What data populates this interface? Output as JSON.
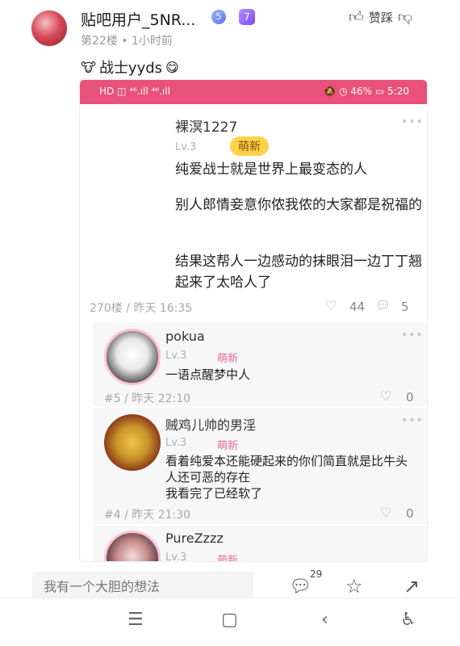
{
  "post": {
    "username": "贴吧用户_5NR...",
    "badge_number": "5",
    "badge_level": "7",
    "meta": "第22楼 • 1小时前",
    "like_label": "赞踩",
    "text": "战士yyds",
    "emoji_prefix": "🐮",
    "emoji_suffix": "😋"
  },
  "screenshot": {
    "status_left": "HD ◫ ⁴⁶.ıll ⁴⁶.ıll",
    "status_right": "🔕 ◷ 46% ▭ 5:20",
    "main_comment": {
      "name": "裸溟1227",
      "level": "Lv.3",
      "badge": "萌新",
      "lines": [
        "纯爱战士就是世界上最变态的人",
        "别人郎情妾意你侬我侬的大家都是祝福的",
        "结果这帮人一边感动的抹眼泪一边丁丁翘起来了太哈人了"
      ],
      "footer": "270楼 / 昨天 16:35",
      "likes": "44",
      "replies": "5"
    },
    "replies": [
      {
        "name": "pokua",
        "level": "Lv.3",
        "badge": "萌新",
        "text": "一语点醒梦中人",
        "footer": "#5 / 昨天 22:10",
        "likes": "0"
      },
      {
        "name": "贼鸡儿帅的男淫",
        "level": "Lv.3",
        "badge": "萌新",
        "text": "看着纯爱本还能硬起来的你们简直就是比牛头人还可恶的存在",
        "text2": "我看完了已经软了",
        "footer": "#4 / 昨天 21:30",
        "likes": "0"
      },
      {
        "name": "PureZzzz",
        "level": "Lv.3",
        "badge": "萌新"
      }
    ]
  },
  "bottom": {
    "input_placeholder": "我有一个大胆的想法",
    "message_count": "29"
  },
  "nav": {
    "menu": "☰",
    "home": "▢",
    "back": "‹",
    "accessibility": "♿"
  },
  "colors": {
    "status_bar": "#e8527a",
    "badge_yellow": "#ffd24a",
    "badge_pink": "#e66aa0"
  }
}
